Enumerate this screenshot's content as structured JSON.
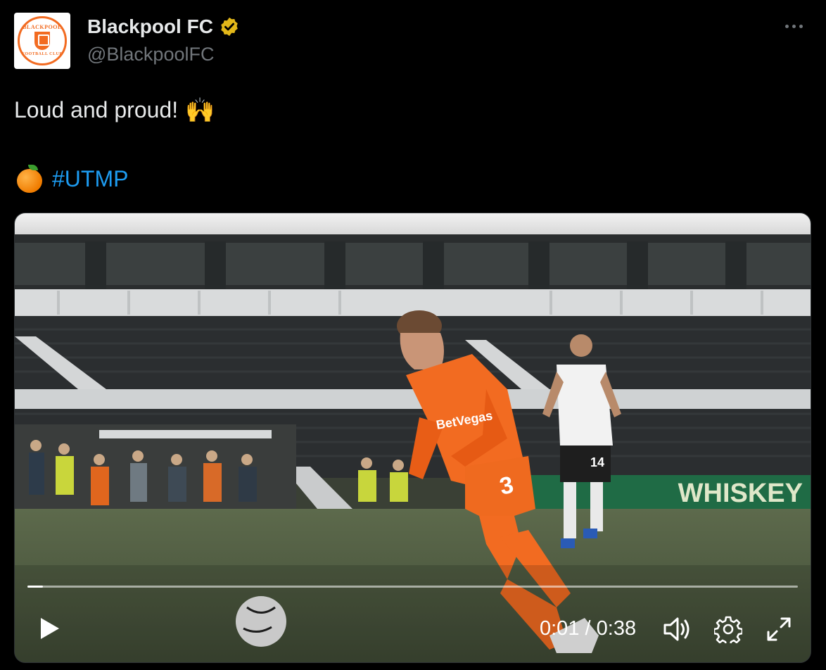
{
  "account": {
    "display_name": "Blackpool FC",
    "handle": "@BlackpoolFC",
    "verified": true,
    "avatar_icon": "blackpool-crest-icon",
    "crest_text_top": "BLACKPOOL",
    "crest_text_bottom": "FOOTBALL CLUB"
  },
  "post": {
    "text": "Loud and proud!",
    "emoji": "🙌",
    "hashtag": "#UTMP",
    "hashtag_emoji_icon": "orange-fruit-icon"
  },
  "video": {
    "current_time": "0:01",
    "duration": "0:38",
    "time_separator": "/",
    "progress_fraction": 0.02,
    "scene": {
      "banner_text": "WHISKEY",
      "player_number": "3",
      "shirt_sponsor": "BetVegas",
      "opponent_number": "14"
    }
  },
  "colors": {
    "hashtag": "#1d9bf0",
    "verified_badge": "#e2b719",
    "secondary_text": "#71767b",
    "kit_orange": "#f26b21"
  },
  "icons": {
    "more": "more-horizontal-icon",
    "play": "play-icon",
    "volume": "volume-icon",
    "settings": "gear-icon",
    "fullscreen": "fullscreen-icon"
  }
}
